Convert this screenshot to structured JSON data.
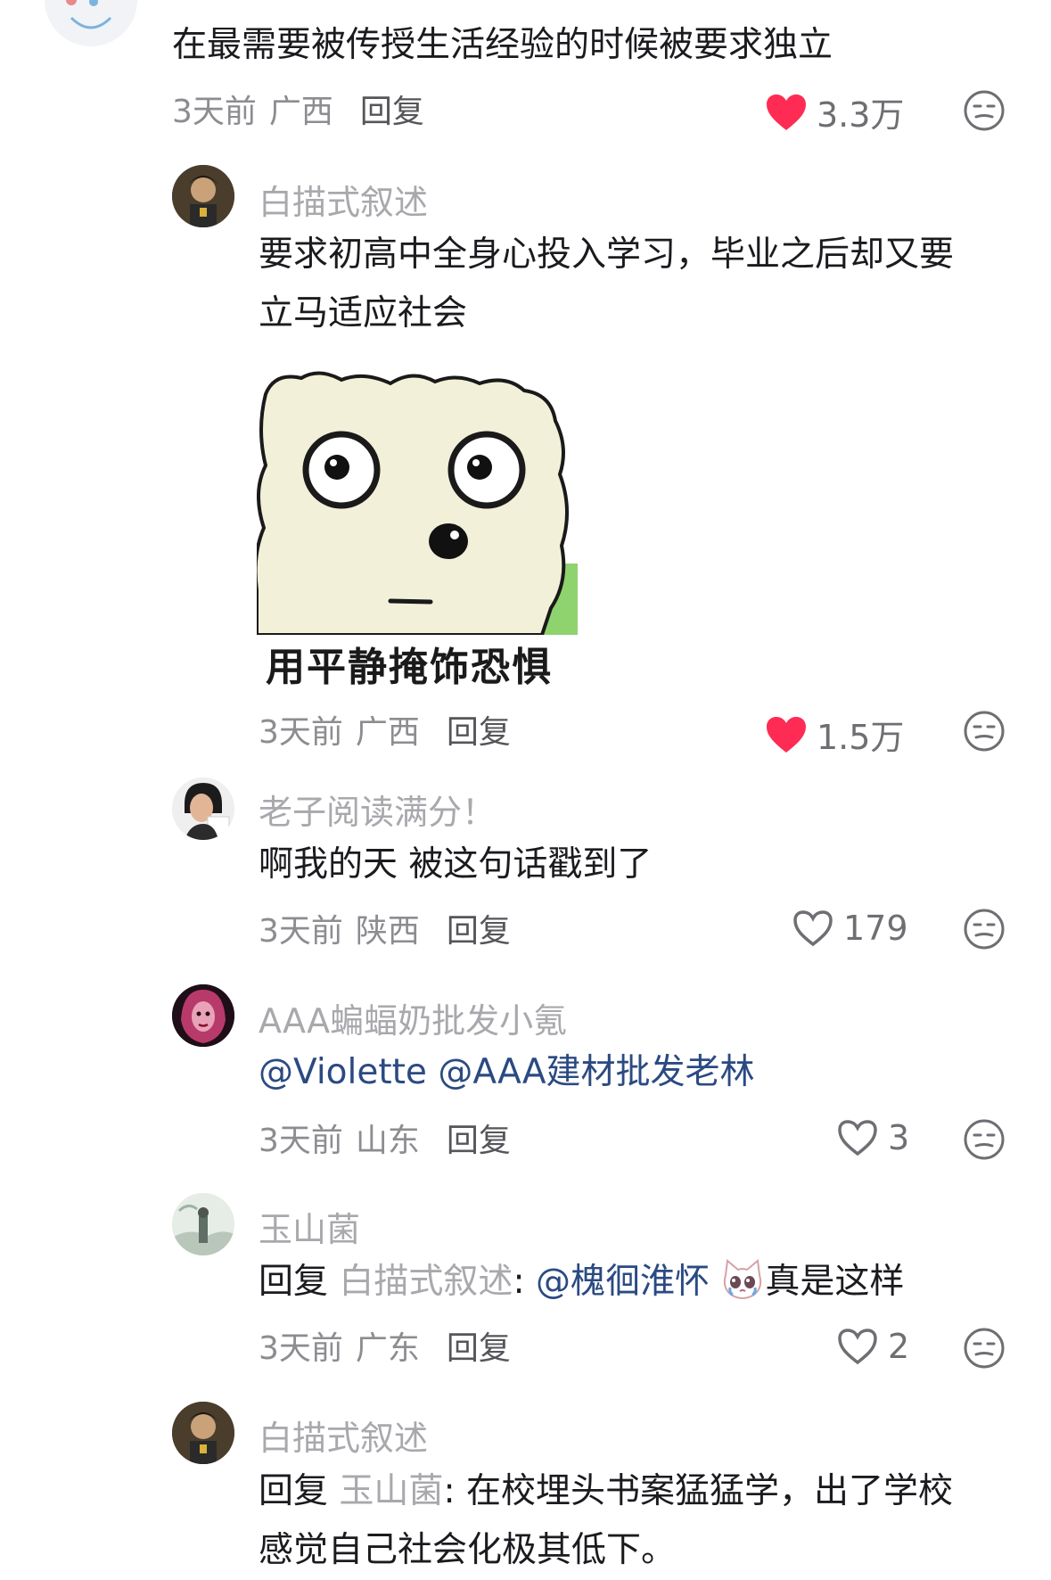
{
  "comments": [
    {
      "text": "在最需要被传授生活经验的时候被要求独立",
      "time": "3天前",
      "region": "广西",
      "reply_label": "回复",
      "likes": "3.3万",
      "liked": true
    },
    {
      "username": "白描式叙述",
      "text_line1": "要求初高中全身心投入学习，毕业之后却又要",
      "text_line2": "立马适应社会",
      "sticker_caption": "用平静掩饰恐惧",
      "time": "3天前",
      "region": "广西",
      "reply_label": "回复",
      "likes": "1.5万",
      "liked": true
    },
    {
      "username": "老子阅读满分！",
      "text": "啊我的天 被这句话戳到了",
      "time": "3天前",
      "region": "陕西",
      "reply_label": "回复",
      "likes": "179",
      "liked": false
    },
    {
      "username": "AAA蝙蝠奶批发小氪",
      "mention1": "@Violette",
      "mention2": "@AAA建材批发老林",
      "time": "3天前",
      "region": "山东",
      "reply_label": "回复",
      "likes": "3",
      "liked": false
    },
    {
      "username": "玉山菌",
      "reply_prefix": "回复",
      "reply_to": "白描式叙述",
      "colon": ":",
      "mention": "@槐徊淮怀",
      "text_after": "真是这样",
      "time": "3天前",
      "region": "广东",
      "reply_label": "回复",
      "likes": "2",
      "liked": false
    },
    {
      "username": "白描式叙述",
      "reply_prefix": "回复",
      "reply_to": "玉山菌",
      "colon": ":",
      "text_line1": "在校埋头书案猛猛学，出了学校",
      "text_line2": "感觉自己社会化极其低下。"
    }
  ],
  "colors": {
    "liked_heart": "#fe2c55",
    "mention": "#2b4a82",
    "meta": "#8c8c91"
  },
  "icons": [
    "heart-filled-icon",
    "heart-outline-icon",
    "dislike-face-icon",
    "crying-cat-emoji-icon"
  ]
}
